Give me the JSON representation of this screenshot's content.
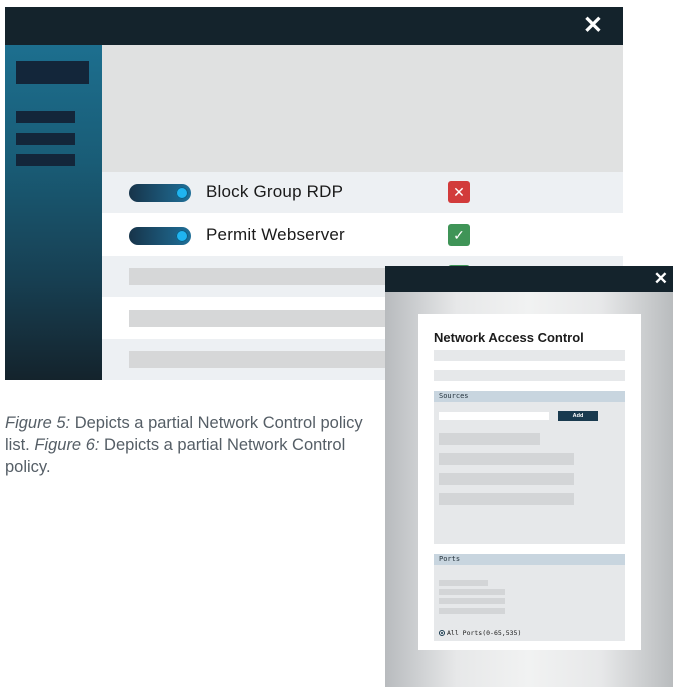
{
  "policy_list_window": {
    "close_icon": "close-icon",
    "rows": [
      {
        "label": "Block Group RDP",
        "enabled": true,
        "status": "deny",
        "status_icon": "x-icon",
        "status_glyph": "✕",
        "status_color": "#d23b3b"
      },
      {
        "label": "Permit Webserver",
        "enabled": true,
        "status": "allow",
        "status_icon": "check-icon",
        "status_glyph": "✓",
        "status_color": "#3f9457"
      }
    ],
    "accent_colors": {
      "titlebar": "#14232c",
      "toggle_knob": "#1fb4f0"
    }
  },
  "caption": {
    "fig5_label": "Figure 5:",
    "fig5_text": " Depicts a partial Network Control policy list. ",
    "fig6_label": "Figure 6:",
    "fig6_text": " Depicts a partial Network Control policy."
  },
  "policy_detail_window": {
    "close_icon": "close-icon",
    "title": "Network Access Control",
    "sources": {
      "header": "Sources",
      "add_label": "Add"
    },
    "ports": {
      "header": "Ports",
      "radio_label": "All Ports(0-65,535)",
      "radio_selected": true
    }
  }
}
